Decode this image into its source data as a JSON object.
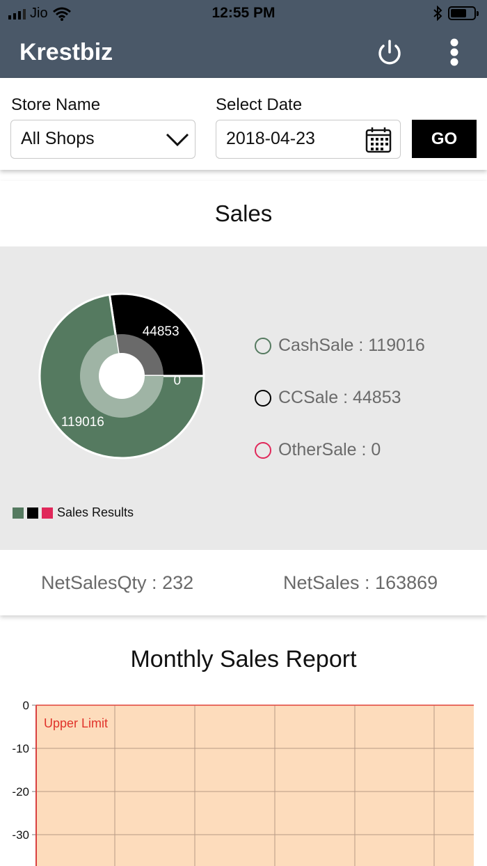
{
  "status_bar": {
    "carrier": "Jio",
    "time": "12:55 PM"
  },
  "app": {
    "title": "Krestbiz"
  },
  "filters": {
    "store_label": "Store Name",
    "store_value": "All Shops",
    "date_label": "Select Date",
    "date_value": "2018-04-23",
    "go_label": "GO"
  },
  "sales": {
    "title": "Sales",
    "legend": [
      {
        "label": "CashSale : 119016",
        "color": "#557a60"
      },
      {
        "label": "CCSale : 44853",
        "color": "#000000"
      },
      {
        "label": "OtherSale : 0",
        "color": "#e0285a"
      }
    ],
    "series_legend_label": "Sales Results",
    "net_sales_qty": "NetSalesQty : 232",
    "net_sales": "NetSales : 163869"
  },
  "monthly": {
    "title": "Monthly Sales Report",
    "upper_limit_label": "Upper Limit"
  },
  "chart_data": [
    {
      "type": "pie",
      "categories": [
        "CashSale",
        "CCSale",
        "OtherSale"
      ],
      "values": [
        119016,
        44853,
        0
      ],
      "data_labels": [
        "119016",
        "44853",
        "0"
      ],
      "colors": [
        "#557a60",
        "#000000",
        "#e0285a"
      ],
      "legend": "right",
      "series_name": "Sales Results"
    },
    {
      "type": "line",
      "title": "Monthly Sales Report",
      "y_ticks": [
        "0",
        "-10",
        "-20",
        "-30"
      ],
      "ylim": [
        -37,
        0
      ],
      "grid": true,
      "annotation": "Upper Limit",
      "upper_limit": 0
    }
  ]
}
